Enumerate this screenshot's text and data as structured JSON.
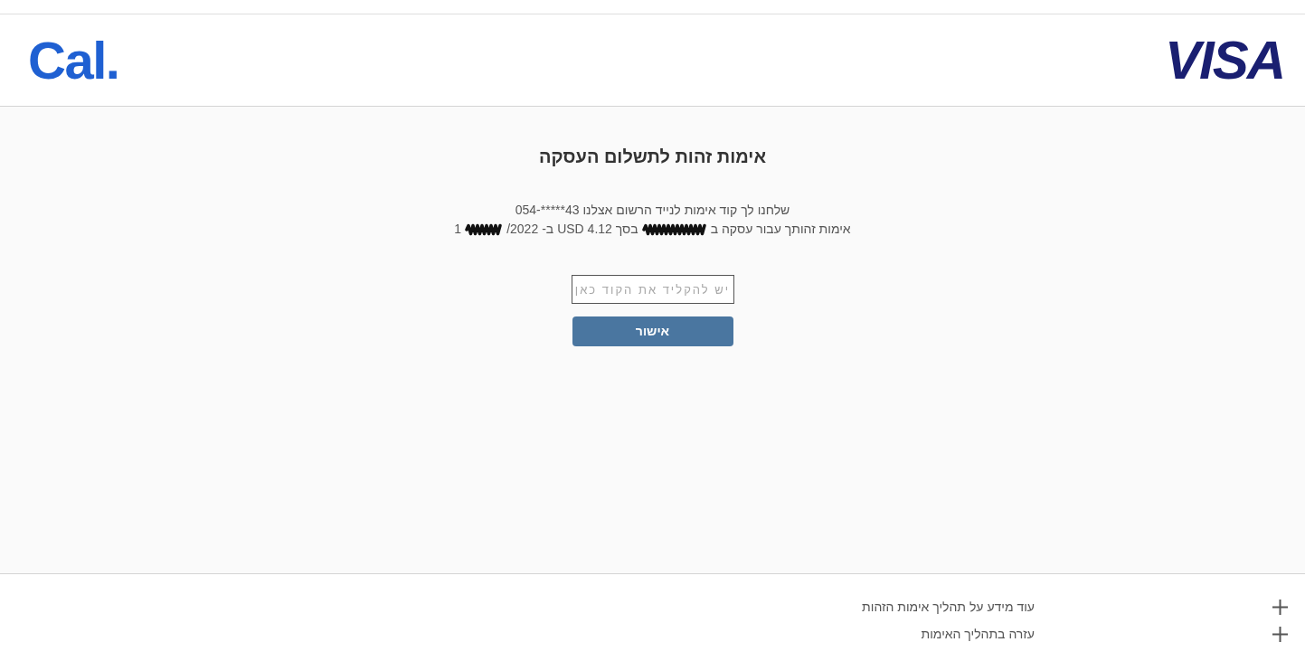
{
  "header": {
    "logo_left": "Cal.",
    "logo_right": "VISA"
  },
  "verification": {
    "title": "אימות זהות לתשלום העסקה",
    "message_lines": [
      {
        "parts": [
          {
            "kind": "text",
            "text": "שלחנו לך קוד אימות לנייד הרשום אצלנו 43*****-054"
          }
        ]
      },
      {
        "parts": [
          {
            "kind": "text",
            "text": "אימות זהותך עבור עסקה ב"
          },
          {
            "kind": "redacted"
          },
          {
            "kind": "text",
            "text": "בסך USD 4.12 ב-"
          },
          {
            "kind": "text",
            "text": "/2022"
          },
          {
            "kind": "redacted"
          },
          {
            "kind": "text",
            "text": "1"
          }
        ]
      }
    ],
    "code_field": {
      "placeholder": "יש להקליד את הקוד כאן"
    },
    "submit_button": "אישור"
  },
  "footer": {
    "items": [
      {
        "label": "עוד מידע על תהליך אימות הזהות",
        "expanded": false
      },
      {
        "label": "עזרה בתהליך האימות",
        "expanded": false
      }
    ]
  }
}
